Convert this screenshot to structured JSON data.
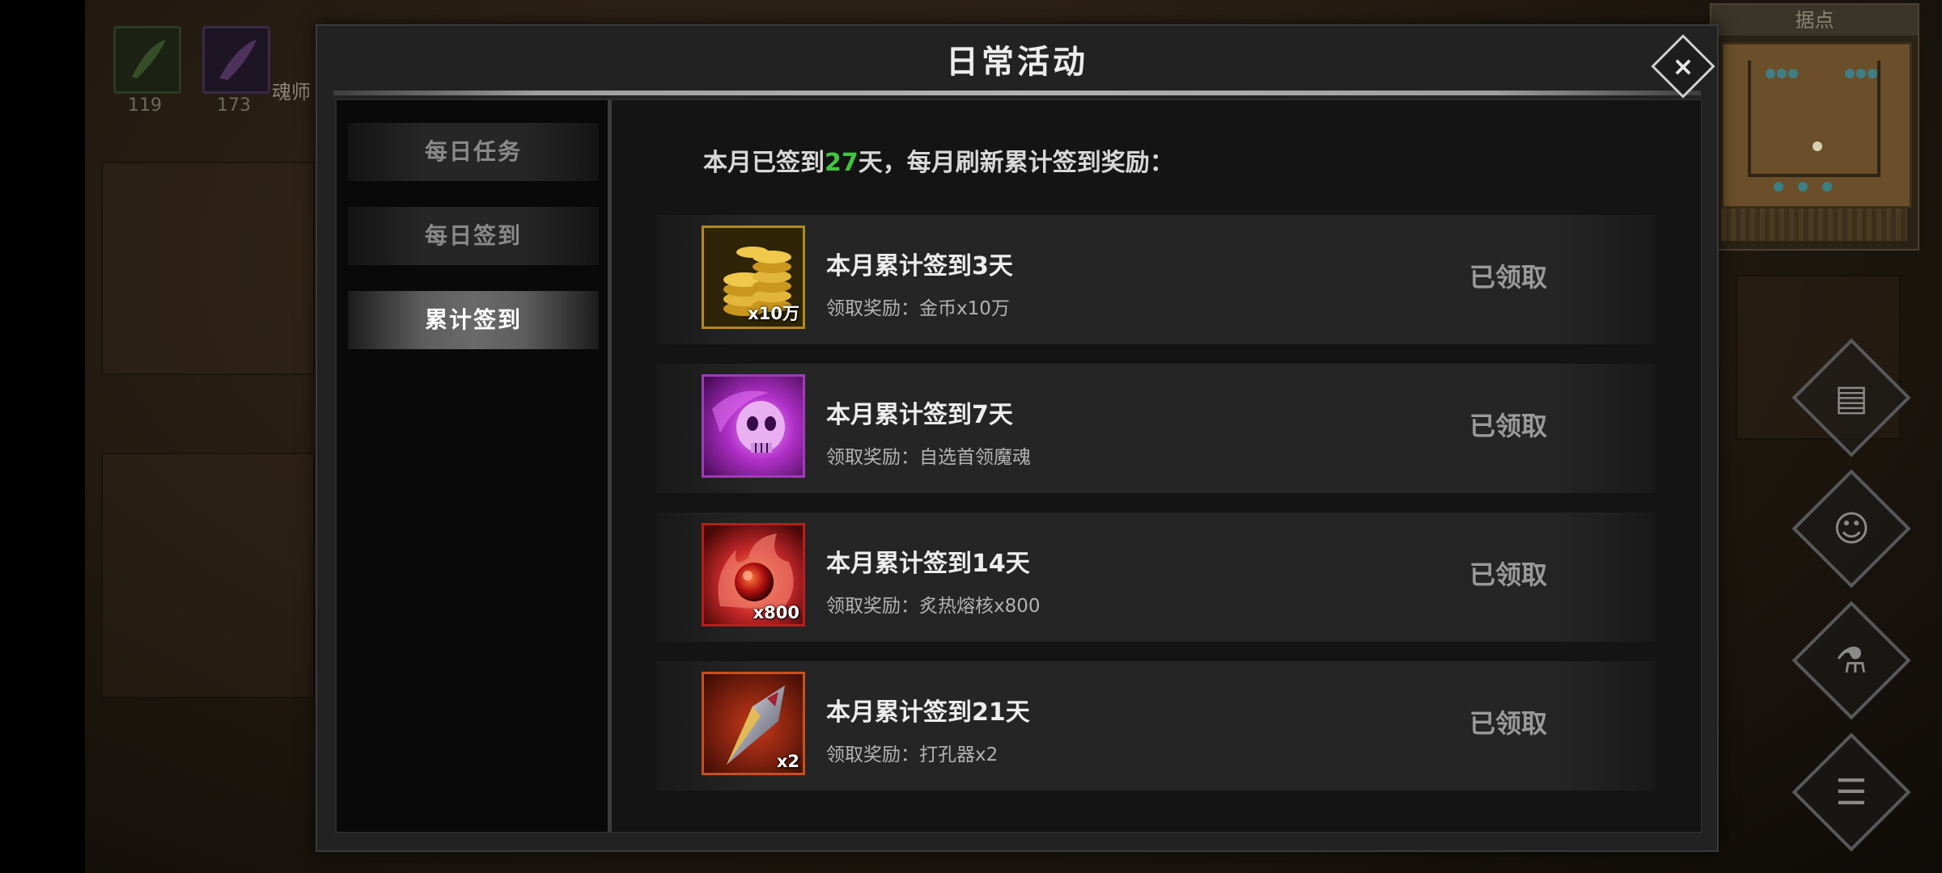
{
  "hud": {
    "skill_slots": [
      {
        "count": "119",
        "icon": "feather-skill-icon"
      },
      {
        "count": "173",
        "icon": "arcane-skill-icon"
      }
    ],
    "hero_label": "魂师",
    "minimap_title": "据点",
    "side_buttons": [
      "scroll-icon",
      "friends-icon",
      "potion-icon",
      "list-menu-icon"
    ]
  },
  "dialog": {
    "title": "日常活动",
    "close_icon": "×",
    "tabs": [
      {
        "label": "每日任务",
        "active": false
      },
      {
        "label": "每日签到",
        "active": false
      },
      {
        "label": "累计签到",
        "active": true
      }
    ],
    "summary": {
      "prefix": "本月已签到",
      "days": "27",
      "suffix": "天，每月刷新累计签到奖励："
    },
    "rewards": [
      {
        "title": "本月累计签到3天",
        "reward": "领取奖励：金币x10万",
        "quantity": "x10万",
        "icon": "gold-coins-icon",
        "status": "已领取"
      },
      {
        "title": "本月累计签到7天",
        "reward": "领取奖励：自选首领魔魂",
        "quantity": "",
        "icon": "purple-skull-soul-icon",
        "status": "已领取"
      },
      {
        "title": "本月累计签到14天",
        "reward": "领取奖励：炙热熔核x800",
        "quantity": "x800",
        "icon": "fire-core-icon",
        "status": "已领取"
      },
      {
        "title": "本月累计签到21天",
        "reward": "领取奖励：打孔器x2",
        "quantity": "x2",
        "icon": "punch-blade-icon",
        "status": "已领取"
      }
    ],
    "colors": {
      "highlight_number": "#3fc640",
      "gold_frame": "#b08a1e",
      "purple_frame": "#a03cb4",
      "red_frame": "#b81e1e",
      "orange_frame": "#c8501e"
    }
  }
}
